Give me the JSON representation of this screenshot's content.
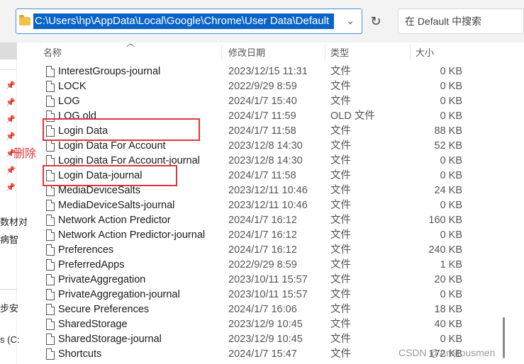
{
  "address_bar": {
    "path": "C:\\Users\\hp\\AppData\\Local\\Google\\Chrome\\User Data\\Default"
  },
  "search": {
    "placeholder": "在 Default 中搜索"
  },
  "columns": {
    "name": "名称",
    "date": "修改日期",
    "type": "类型",
    "size": "大小"
  },
  "nav_fragments": [
    "数材对",
    "病智",
    "步安",
    "s (C:"
  ],
  "files": [
    {
      "name": "InterestGroups-journal",
      "date": "2023/12/15 11:31",
      "type": "文件",
      "size": "0 KB"
    },
    {
      "name": "LOCK",
      "date": "2022/9/29 8:59",
      "type": "文件",
      "size": "0 KB"
    },
    {
      "name": "LOG",
      "date": "2024/1/7 15:40",
      "type": "文件",
      "size": "0 KB"
    },
    {
      "name": "LOG.old",
      "date": "2024/1/7 11:59",
      "type": "OLD 文件",
      "size": "0 KB"
    },
    {
      "name": "Login Data",
      "date": "2024/1/7 11:58",
      "type": "文件",
      "size": "88 KB"
    },
    {
      "name": "Login Data For Account",
      "date": "2023/12/8 14:30",
      "type": "文件",
      "size": "52 KB"
    },
    {
      "name": "Login Data For Account-journal",
      "date": "2023/12/8 14:30",
      "type": "文件",
      "size": "0 KB"
    },
    {
      "name": "Login Data-journal",
      "date": "2024/1/7 11:58",
      "type": "文件",
      "size": "0 KB"
    },
    {
      "name": "MediaDeviceSalts",
      "date": "2023/12/11 10:46",
      "type": "文件",
      "size": "24 KB"
    },
    {
      "name": "MediaDeviceSalts-journal",
      "date": "2023/12/11 10:46",
      "type": "文件",
      "size": "0 KB"
    },
    {
      "name": "Network Action Predictor",
      "date": "2024/1/7 16:12",
      "type": "文件",
      "size": "160 KB"
    },
    {
      "name": "Network Action Predictor-journal",
      "date": "2024/1/7 16:12",
      "type": "文件",
      "size": "0 KB"
    },
    {
      "name": "Preferences",
      "date": "2024/1/7 16:12",
      "type": "文件",
      "size": "240 KB"
    },
    {
      "name": "PreferredApps",
      "date": "2022/9/29 8:59",
      "type": "文件",
      "size": "1 KB"
    },
    {
      "name": "PrivateAggregation",
      "date": "2023/10/11 15:57",
      "type": "文件",
      "size": "20 KB"
    },
    {
      "name": "PrivateAggregation-journal",
      "date": "2023/10/11 15:57",
      "type": "文件",
      "size": "0 KB"
    },
    {
      "name": "Secure Preferences",
      "date": "2024/1/7 16:06",
      "type": "文件",
      "size": "18 KB"
    },
    {
      "name": "SharedStorage",
      "date": "2023/12/9 10:45",
      "type": "文件",
      "size": "40 KB"
    },
    {
      "name": "SharedStorage-journal",
      "date": "2023/12/9 10:45",
      "type": "文件",
      "size": "0 KB"
    },
    {
      "name": "Shortcuts",
      "date": "2024/1/7 15:47",
      "type": "文件",
      "size": "172 KB"
    }
  ],
  "annotation": {
    "text": "删除"
  },
  "watermark": "CSDN @Arbitousmen",
  "colors": {
    "highlight": "#e0353b",
    "selection": "#0a64c8"
  }
}
